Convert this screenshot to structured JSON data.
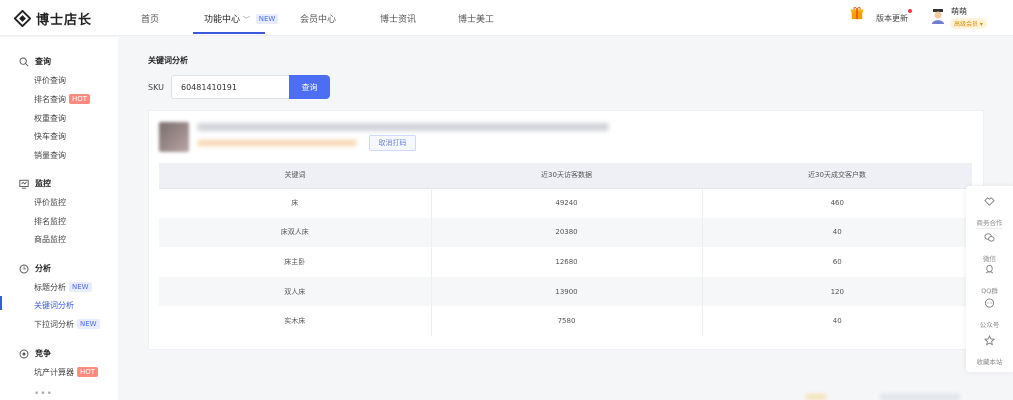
{
  "header": {
    "logo_text": "博士店长",
    "nav": [
      "首页",
      "功能中心",
      "会员中心",
      "博士资讯",
      "博士美工"
    ],
    "nav_new_badge": "NEW",
    "version_label": "版本更新",
    "user_name": "萌萌",
    "user_level": "高级会员 ▾"
  },
  "sidebar": {
    "sections": [
      {
        "title": "查询",
        "icon": "search-icon",
        "items": [
          {
            "label": "评价查询"
          },
          {
            "label": "排名查询",
            "badge": "HOT"
          },
          {
            "label": "权重查询"
          },
          {
            "label": "快车查询"
          },
          {
            "label": "销量查询"
          }
        ]
      },
      {
        "title": "监控",
        "icon": "monitor-icon",
        "items": [
          {
            "label": "评价监控"
          },
          {
            "label": "排名监控"
          },
          {
            "label": "商品监控"
          }
        ]
      },
      {
        "title": "分析",
        "icon": "clock-icon",
        "items": [
          {
            "label": "标题分析",
            "badge": "NEW"
          },
          {
            "label": "关键词分析",
            "active": true
          },
          {
            "label": "下拉词分析",
            "badge": "NEW"
          }
        ]
      },
      {
        "title": "竞争",
        "icon": "target-icon",
        "items": [
          {
            "label": "坑产计算器",
            "badge": "HOT"
          }
        ]
      }
    ],
    "more": "•••"
  },
  "main": {
    "title": "关键词分析",
    "sku_label": "SKU",
    "sku_value": "60481410191",
    "query_button": "查询",
    "cancel_tag": "取消打码",
    "table": {
      "headers": [
        "关键词",
        "近30天访客数据",
        "近30天成交客户数"
      ],
      "rows": [
        [
          "床",
          "49240",
          "460"
        ],
        [
          "床双人床",
          "20380",
          "40"
        ],
        [
          "床主卧",
          "12680",
          "60"
        ],
        [
          "双人床",
          "13900",
          "120"
        ],
        [
          "实木床",
          "7580",
          "40"
        ]
      ]
    }
  },
  "float_toolbar": [
    {
      "label": "商务合作",
      "icon": "handshake-icon"
    },
    {
      "label": "微信",
      "icon": "wechat-icon"
    },
    {
      "label": "QQ群",
      "icon": "qq-icon"
    },
    {
      "label": "公众号",
      "icon": "chat-icon"
    },
    {
      "label": "收藏本站",
      "icon": "star-icon"
    }
  ],
  "colors": {
    "accent": "#4c6ef5",
    "hot": "#ff8a80"
  }
}
